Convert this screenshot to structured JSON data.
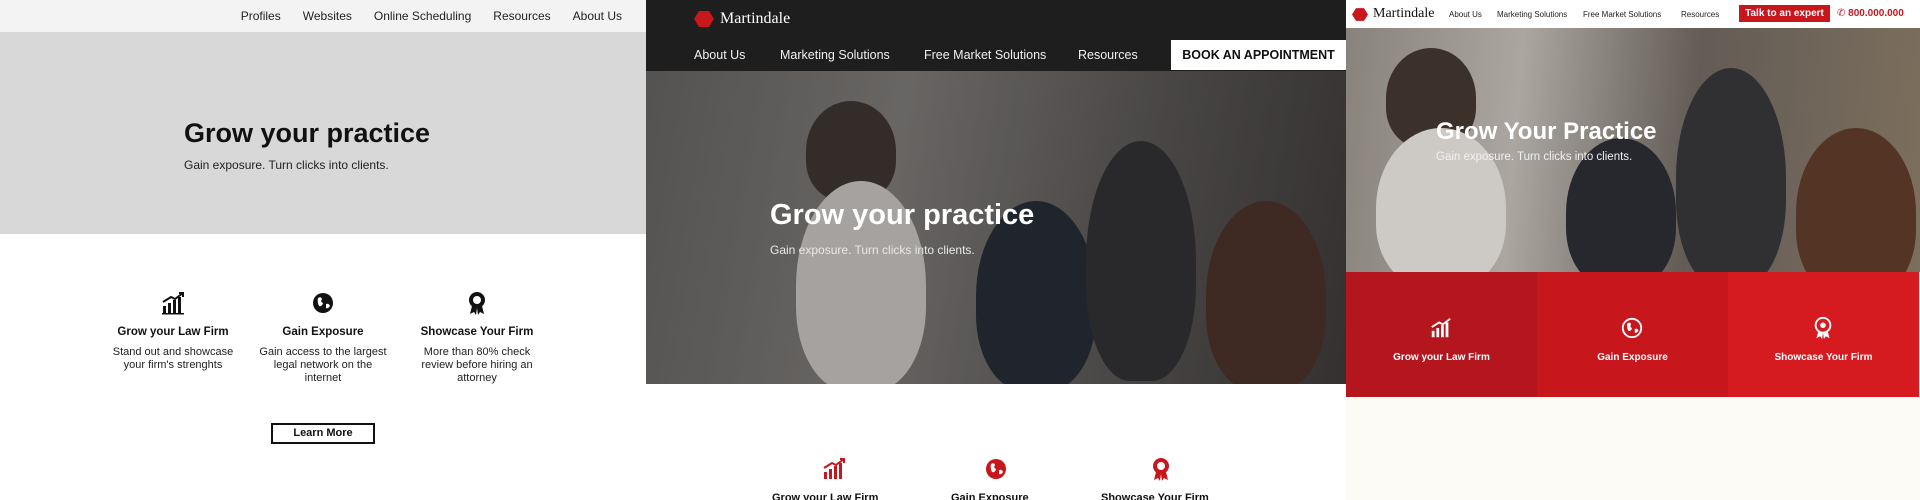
{
  "colors": {
    "brand_red": "#c8161d",
    "dark_nav": "#1e1e1e",
    "wire_gray": "#d8d8d8"
  },
  "panel_a": {
    "nav": [
      "Profiles",
      "Websites",
      "Online Scheduling",
      "Resources",
      "About Us"
    ],
    "hero_title": "Grow your practice",
    "hero_subtitle": "Gain exposure. Turn clicks into clients.",
    "features": [
      {
        "title": "Grow your Law Firm",
        "text": "Stand out and showcase your firm's strenghts",
        "icon": "growth-chart-icon"
      },
      {
        "title": "Gain Exposure",
        "text": "Gain access to the largest legal network on the internet",
        "icon": "globe-icon"
      },
      {
        "title": "Showcase Your Firm",
        "text": "More than 80% check review before hiring an attorney",
        "icon": "award-ribbon-icon"
      }
    ],
    "button": "Learn More"
  },
  "panel_b": {
    "brand": "Martindale",
    "nav": [
      "About Us",
      "Marketing Solutions",
      "Free Market Solutions",
      "Resources"
    ],
    "cta": "BOOK AN APPOINTMENT",
    "hero_title": "Grow your practice",
    "hero_subtitle": "Gain exposure. Turn clicks into clients.",
    "features": [
      "Grow your Law Firm",
      "Gain Exposure",
      "Showcase Your Firm"
    ]
  },
  "panel_c": {
    "brand": "Martindale",
    "nav": [
      "About Us",
      "Marketing Solutions",
      "Free Market Solutions",
      "Resources"
    ],
    "cta": "Talk to an expert",
    "phone": "800.000.000",
    "hero_title": "Grow Your Practice",
    "hero_subtitle": "Gain exposure. Turn clicks into clients.",
    "tiles": [
      {
        "label": "Grow your Law Firm",
        "color": "#b5151c"
      },
      {
        "label": "Gain Exposure",
        "color": "#c8161d"
      },
      {
        "label": "Showcase Your Firm",
        "color": "#d51a20"
      }
    ]
  }
}
